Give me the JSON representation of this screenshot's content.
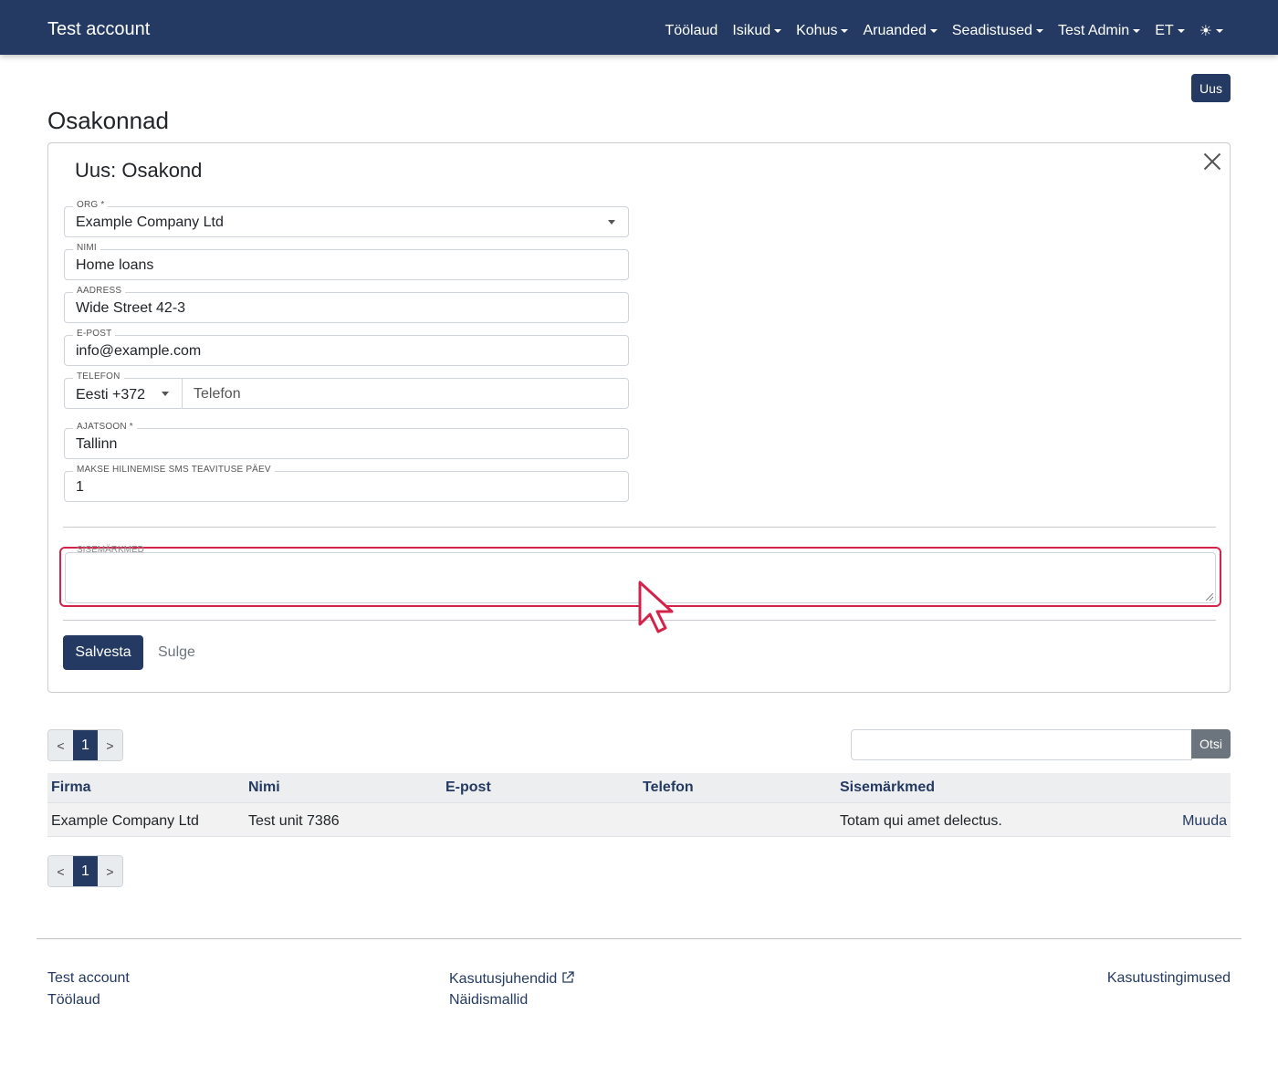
{
  "navbar": {
    "brand": "Test account",
    "items": [
      {
        "label": "Töölaud",
        "dropdown": false
      },
      {
        "label": "Isikud",
        "dropdown": true
      },
      {
        "label": "Kohus",
        "dropdown": true
      },
      {
        "label": "Aruanded",
        "dropdown": true
      },
      {
        "label": "Seadistused",
        "dropdown": true
      },
      {
        "label": "Test Admin",
        "dropdown": true
      },
      {
        "label": "ET",
        "dropdown": true
      }
    ],
    "theme_icon": "☀"
  },
  "toolbar": {
    "new_label": "Uus"
  },
  "page": {
    "title": "Osakonnad"
  },
  "form": {
    "title": "Uus: Osakond",
    "org": {
      "label": "ORG *",
      "value": "Example Company Ltd"
    },
    "nimi": {
      "label": "NIMI",
      "value": "Home loans"
    },
    "aadress": {
      "label": "AADRESS",
      "value": "Wide Street 42-3"
    },
    "epost": {
      "label": "E-POST",
      "value": "info@example.com"
    },
    "telefon": {
      "label": "TELEFON",
      "country": "Eesti +372",
      "placeholder": "Telefon"
    },
    "ajatsoon": {
      "label": "AJATSOON *",
      "value": "Tallinn"
    },
    "sms": {
      "label": "MAKSE HILINEMISE SMS TEAVITUSE PÄEV",
      "value": "1"
    },
    "sisemarkmed": {
      "label": "SISEMÄRKMED",
      "value": ""
    },
    "save_label": "Salvesta",
    "close_label": "Sulge"
  },
  "pagination": {
    "prev": "<",
    "current": "1",
    "next": ">"
  },
  "search": {
    "button_label": "Otsi",
    "value": ""
  },
  "table": {
    "headers": [
      "Firma",
      "Nimi",
      "E-post",
      "Telefon",
      "Sisemärkmed"
    ],
    "rows": [
      {
        "firma": "Example Company Ltd",
        "nimi": "Test unit 7386",
        "epost": "",
        "telefon": "",
        "sisemarkmed": "Totam qui amet delectus.",
        "action": "Muuda"
      }
    ]
  },
  "footer": {
    "col1": [
      "Test account",
      "Töölaud"
    ],
    "col2": [
      "Kasutusjuhendid",
      "Näidismallid"
    ],
    "col3": [
      "Kasutustingimused"
    ]
  },
  "colors": {
    "primary": "#253a62",
    "highlight": "#d4234b",
    "secondary": "#6c757d"
  }
}
